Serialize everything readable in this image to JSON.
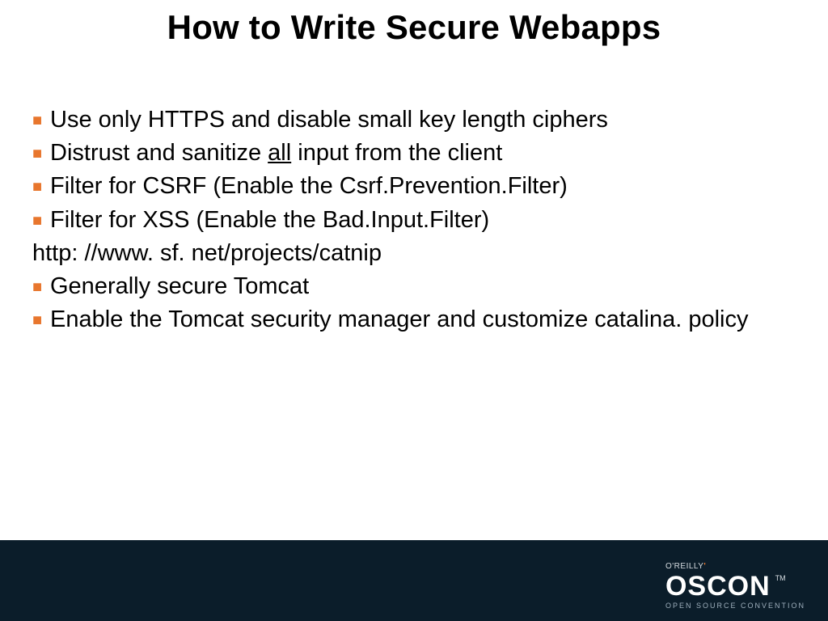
{
  "title": "How to Write Secure Webapps",
  "bullets": {
    "b1": "Use only HTTPS and disable small key length ciphers",
    "b2_pre": "Distrust and sanitize ",
    "b2_em": "all",
    "b2_post": " input from the client",
    "b3": "Filter for CSRF (Enable the Csrf.Prevention.Filter)",
    "b4": "Filter for XSS (Enable the Bad.Input.Filter)",
    "plain1": "http: //www. sf. net/projects/catnip",
    "b5": "Generally secure Tomcat",
    "b6": "Enable the Tomcat security manager and customize catalina. policy"
  },
  "footer": {
    "publisher": "O'REILLY",
    "conference": "OSCON",
    "tagline": "OPEN SOURCE CONVENTION",
    "tm": "TM"
  },
  "glyphs": {
    "square": "■",
    "tick": "'"
  }
}
